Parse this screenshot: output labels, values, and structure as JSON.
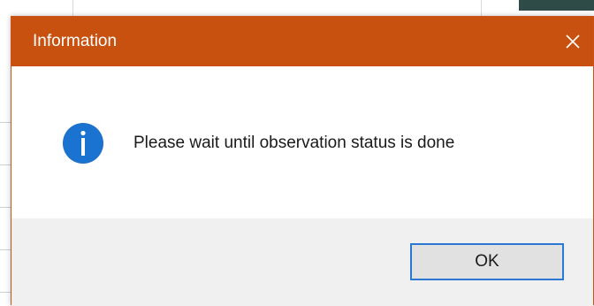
{
  "dialog": {
    "title": "Information",
    "message": "Please wait until observation status is done",
    "ok_label": "OK",
    "icon": "info-icon",
    "close_icon": "close-icon"
  },
  "colors": {
    "title_bar": "#c8510f",
    "info_icon": "#1f6fc5",
    "button_focus_border": "#2b78d3",
    "footer_bg": "#f0f0f0"
  }
}
